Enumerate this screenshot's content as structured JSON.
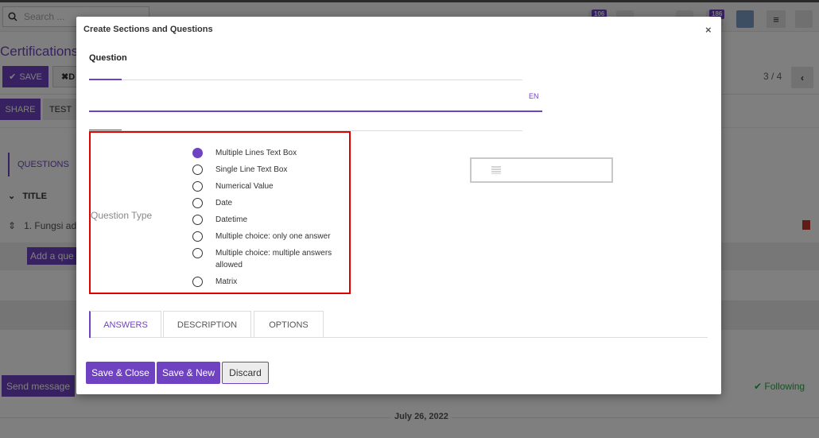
{
  "background": {
    "search_placeholder": "Search ...",
    "badge_left": "106",
    "badge_right": "186",
    "breadcrumb_title": "Certifications",
    "save_label": "SAVE",
    "discard_label": "D",
    "pager": "3 / 4",
    "share_label": "SHARE",
    "test_label": "TEST",
    "questions_tab": "QUESTIONS",
    "title_header": "TITLE",
    "row_text": "1. Fungsi ad",
    "add_question": "Add a que",
    "send_message": "Send message",
    "following": "Following",
    "date": "July 26, 2022"
  },
  "modal": {
    "title": "Create Sections and Questions",
    "close_glyph": "×",
    "question_label": "Question",
    "question_value": "",
    "lang": "EN",
    "question_type_label": "Question Type",
    "question_types": [
      {
        "label": "Multiple Lines Text Box",
        "checked": true
      },
      {
        "label": "Single Line Text Box",
        "checked": false
      },
      {
        "label": "Numerical Value",
        "checked": false
      },
      {
        "label": "Date",
        "checked": false
      },
      {
        "label": "Datetime",
        "checked": false
      },
      {
        "label": "Multiple choice: only one answer",
        "checked": false
      },
      {
        "label": "Multiple choice: multiple answers allowed",
        "checked": false
      },
      {
        "label": "Matrix",
        "checked": false
      }
    ],
    "preview_icon": "text-lines-icon",
    "tabs": [
      "ANSWERS",
      "DESCRIPTION",
      "OPTIONS"
    ],
    "active_tab": "ANSWERS",
    "buttons": {
      "save_close": "Save & Close",
      "save_new": "Save & New",
      "discard": "Discard"
    }
  },
  "colors": {
    "accent": "#6f42c1",
    "highlight_border": "#e00000",
    "following": "#28a745"
  }
}
